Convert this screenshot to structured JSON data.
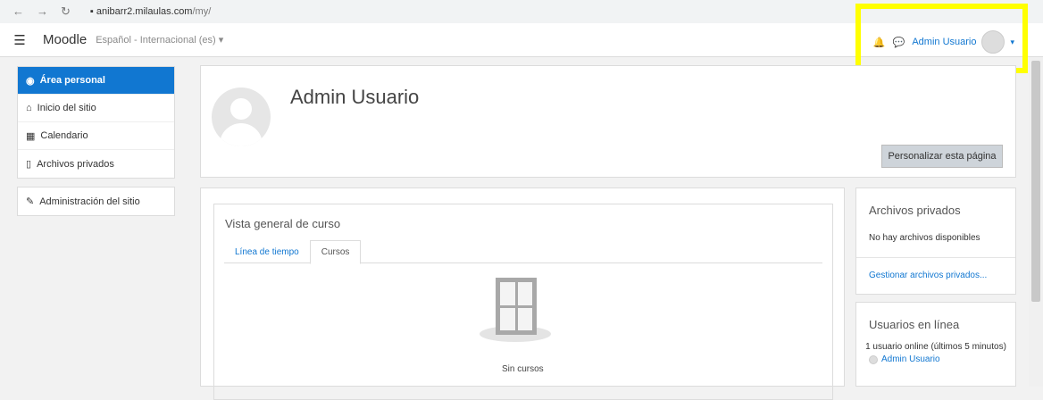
{
  "browser": {
    "url_host": "anibarr2.milaulas.com",
    "url_path": "/my/"
  },
  "navbar": {
    "brand": "Moodle",
    "language": "Español - Internacional (es) ▾",
    "user_name": "Admin Usuario"
  },
  "sidebar": {
    "items": [
      {
        "label": "Área personal",
        "icon": "dashboard-icon",
        "active": true
      },
      {
        "label": "Inicio del sitio",
        "icon": "home-icon"
      },
      {
        "label": "Calendario",
        "icon": "calendar-icon"
      },
      {
        "label": "Archivos privados",
        "icon": "file-icon"
      }
    ],
    "admin": {
      "label": "Administración del sitio",
      "icon": "wrench-icon"
    }
  },
  "header": {
    "name": "Admin Usuario",
    "customize_button": "Personalizar esta página"
  },
  "course_overview": {
    "title": "Vista general de curso",
    "tabs": [
      "Línea de tiempo",
      "Cursos"
    ],
    "active_tab": "Cursos",
    "empty_text": "Sin cursos"
  },
  "private_files": {
    "title": "Archivos privados",
    "empty": "No hay archivos disponibles",
    "manage_link": "Gestionar archivos privados..."
  },
  "online_users": {
    "title": "Usuarios en línea",
    "summary": "1 usuario online (últimos 5 minutos)",
    "user": "Admin Usuario"
  },
  "colors": {
    "accent": "#1177d1",
    "highlight": "#ffff00"
  }
}
